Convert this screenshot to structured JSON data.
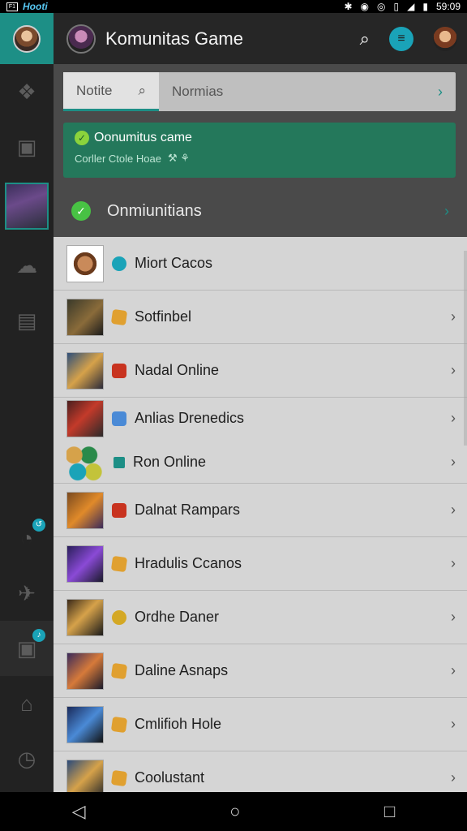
{
  "status_bar": {
    "app_badge": "F1",
    "app_name": "Hooti",
    "icons": [
      "bluetooth-icon",
      "location-icon",
      "alarm-icon",
      "vibrate-icon",
      "signal-icon",
      "battery-icon"
    ],
    "time": "59:09"
  },
  "rail": {
    "items": [
      {
        "name": "self-avatar",
        "icon": "avatar"
      },
      {
        "name": "rail-item-fox",
        "icon": "fox-icon"
      },
      {
        "name": "rail-item-chat",
        "icon": "chat-icon"
      },
      {
        "name": "rail-item-game",
        "icon": "game-tile"
      },
      {
        "name": "rail-item-bubble",
        "icon": "bubble-icon"
      },
      {
        "name": "rail-item-inbox",
        "icon": "inbox-icon"
      },
      {
        "name": "rail-item-compass",
        "icon": "compass-icon",
        "badge": "↺"
      },
      {
        "name": "rail-item-run",
        "icon": "run-icon"
      },
      {
        "name": "rail-item-music",
        "icon": "music-chat-icon",
        "badge": "♪"
      },
      {
        "name": "rail-item-home",
        "icon": "house-icon"
      },
      {
        "name": "rail-item-clock",
        "icon": "clock-icon"
      }
    ]
  },
  "topbar": {
    "title": "Komunitas Game",
    "search_icon": "search-icon",
    "notif_glyph": "≡"
  },
  "tabs": {
    "tab_a": "Notite",
    "tab_b": "Normias"
  },
  "banner": {
    "title": "Oonumitus came",
    "subtitle": "Corller Ctole Hoae",
    "extra": "⚒ ⚘"
  },
  "section": {
    "label": "Onmiunitians"
  },
  "games": [
    {
      "name": "Miort Cacos",
      "thumb": "mask",
      "gem": "teal",
      "chevron": false
    },
    {
      "name": "Sotfinbel",
      "thumb": "t1",
      "gem": "orange",
      "chevron": true
    },
    {
      "name": "Nadal Online",
      "thumb": "t2",
      "gem": "red",
      "chevron": true
    },
    {
      "name": "Anlias Drenedics",
      "thumb": "t3",
      "gem": "blue",
      "chevron": true
    },
    {
      "name": "Ron Online",
      "thumb": "orbs",
      "gem": "square",
      "chevron": true
    },
    {
      "name": "Dalnat Rampars",
      "thumb": "t4",
      "gem": "red",
      "chevron": true
    },
    {
      "name": "Hradulis Ccanos",
      "thumb": "t5",
      "gem": "orange",
      "chevron": true
    },
    {
      "name": "Ordhe Daner",
      "thumb": "t6",
      "gem": "yellow",
      "chevron": true
    },
    {
      "name": "Daline Asnaps",
      "thumb": "t7",
      "gem": "orange",
      "chevron": true
    },
    {
      "name": "Cmlifioh Hole",
      "thumb": "t8",
      "gem": "orange",
      "chevron": true
    },
    {
      "name": "Coolustant",
      "thumb": "t9",
      "gem": "orange",
      "chevron": true
    }
  ],
  "nav": {
    "back": "◁",
    "home": "○",
    "recent": "□"
  },
  "colors": {
    "accent": "#1d8f86",
    "banner": "#24785b",
    "badge": "#1aa3b8"
  }
}
